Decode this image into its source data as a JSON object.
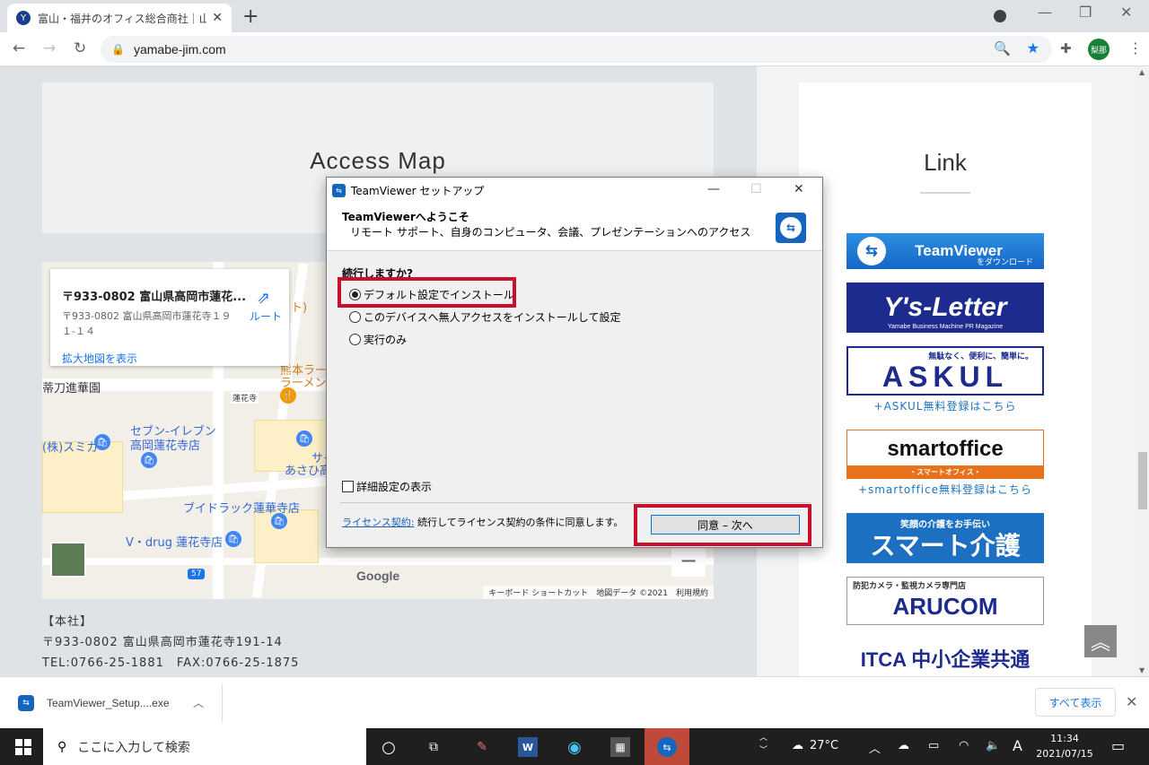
{
  "browser": {
    "tab_title": "富山・福井のオフィス総合商社｜山",
    "tab_close": "✕",
    "new_tab": "+",
    "url": "yamabe-jim.com",
    "profile_label": "梨那"
  },
  "page": {
    "access_title": "Access Map",
    "link_title": "Link",
    "address_lines": [
      "【本社】",
      "〒933-0802 富山県高岡市蓮花寺191-14",
      "TEL:0766-25-1881　FAX:0766-25-1875"
    ]
  },
  "map": {
    "card_name": "〒933-0802 富山県高岡市蓮花...",
    "card_addr": "〒933-0802 富山県高岡市蓮花寺１９１-１４",
    "card_enlarge": "拡大地図を表示",
    "card_route": "ルート",
    "labels": {
      "hanadachi": "蒂刀進華園",
      "sumika": "(株)スミカ",
      "seven": "セブン-イレブン",
      "seven2": "高岡蓮花寺店",
      "drug": "ブイドラック蓮華寺店",
      "vdrug": "V・drug 蓮花寺店",
      "ramen1": "熊本ラーメ",
      "ramen2": "ラーメン・$$",
      "renge": "蓮花寺",
      "saiku": "サイク",
      "asahi": "あさひ高",
      "to": "ト)"
    },
    "route_num": "57",
    "google": "Google",
    "attribution": "キーボード ショートカット　地図データ ©2021　利用規約"
  },
  "links": {
    "teamviewer": "TeamViewer",
    "teamviewer_sub": "をダウンロード",
    "ysletter": "Y's-Letter",
    "ysletter_sub": "Yamabe Business Machine PR Magazine",
    "askul": "ASKUL",
    "askul_sub": "無駄なく、便利に、簡単に。",
    "askul_caption": "+ASKUL無料登録はこちら",
    "smartoffice": "smartoffice",
    "smartoffice_bar": "・スマートオフィス・",
    "smartoffice_caption": "+smartoffice無料登録はこちら",
    "kaigo": "スマート介護",
    "kaigo_sub": "笑顔の介護をお手伝い",
    "arucom": "ARUCOM",
    "arucom_sub": "防犯カメラ・監視カメラ専門店",
    "itca": "ITCA 中小企業共通"
  },
  "dialog": {
    "title": "TeamViewer セットアップ",
    "welcome": "TeamViewerへようこそ",
    "subtitle": "リモート サポート、自身のコンピュータ、会議、プレゼンテーションへのアクセス",
    "question": "続行しますか?",
    "options": [
      {
        "label": "デフォルト設定でインストール",
        "selected": true
      },
      {
        "label": "このデバイスへ無人アクセスをインストールして設定",
        "selected": false
      },
      {
        "label": "実行のみ",
        "selected": false
      }
    ],
    "advanced": "詳細設定の表示",
    "license_link": "ライセンス契約:",
    "license_text": " 続行してライセンス契約の条件に同意します。",
    "agree_button": "同意 – 次へ",
    "minimize": "—",
    "maximize": "☐",
    "close": "✕"
  },
  "download": {
    "filename": "TeamViewer_Setup....exe",
    "show_all": "すべて表示",
    "close": "✕"
  },
  "taskbar": {
    "search_placeholder": "ここに入力して検索",
    "weather": "27°C",
    "ime": "A",
    "time": "11:34",
    "date": "2021/07/15"
  }
}
